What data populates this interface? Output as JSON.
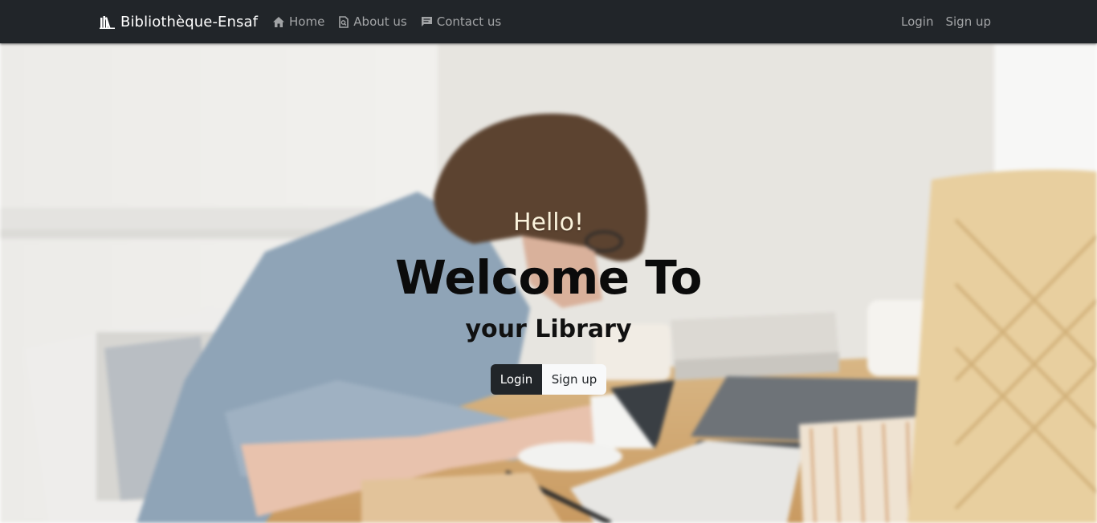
{
  "navbar": {
    "brand": "Bibliothèque-Ensaf",
    "brand_icon": "books-icon",
    "links": [
      {
        "label": "Home",
        "icon": "home-icon"
      },
      {
        "label": "About us",
        "icon": "search-doc-icon"
      },
      {
        "label": "Contact us",
        "icon": "message-icon"
      }
    ],
    "right_links": [
      {
        "label": "Login"
      },
      {
        "label": "Sign up"
      }
    ]
  },
  "hero": {
    "greeting": "Hello!",
    "headline": "Welcome To",
    "subheadline": "your Library",
    "buttons": {
      "login": "Login",
      "signup": "Sign up"
    }
  },
  "colors": {
    "navbar_bg": "#212529",
    "nav_link": "rgba(255,255,255,0.58)",
    "greeting": "#fbf3dc",
    "btn_dark": "#212529",
    "btn_light": "#f8f9fa"
  }
}
